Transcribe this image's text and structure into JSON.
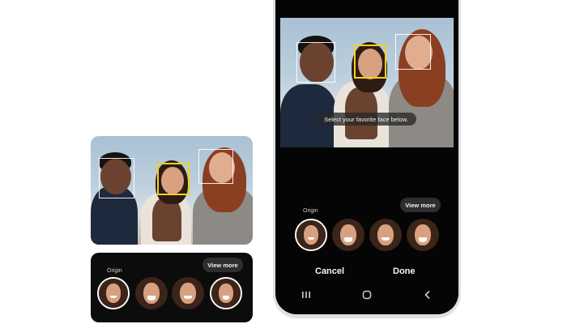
{
  "card": {
    "origin_label": "Origin",
    "view_more_label": "View more"
  },
  "phone": {
    "tooltip": "Select your favorite face below.",
    "origin_label": "Origin",
    "view_more_label": "View more",
    "cancel_label": "Cancel",
    "done_label": "Done"
  },
  "colors": {
    "selection_box": "#f2d21b",
    "face_box": "#ffffff",
    "chooser_bg": "#0c0c0d",
    "phone_frame": "#dfe0e2"
  },
  "icons": {
    "nav_recent": "recent-apps-icon",
    "nav_home": "home-icon",
    "nav_back": "back-icon"
  }
}
